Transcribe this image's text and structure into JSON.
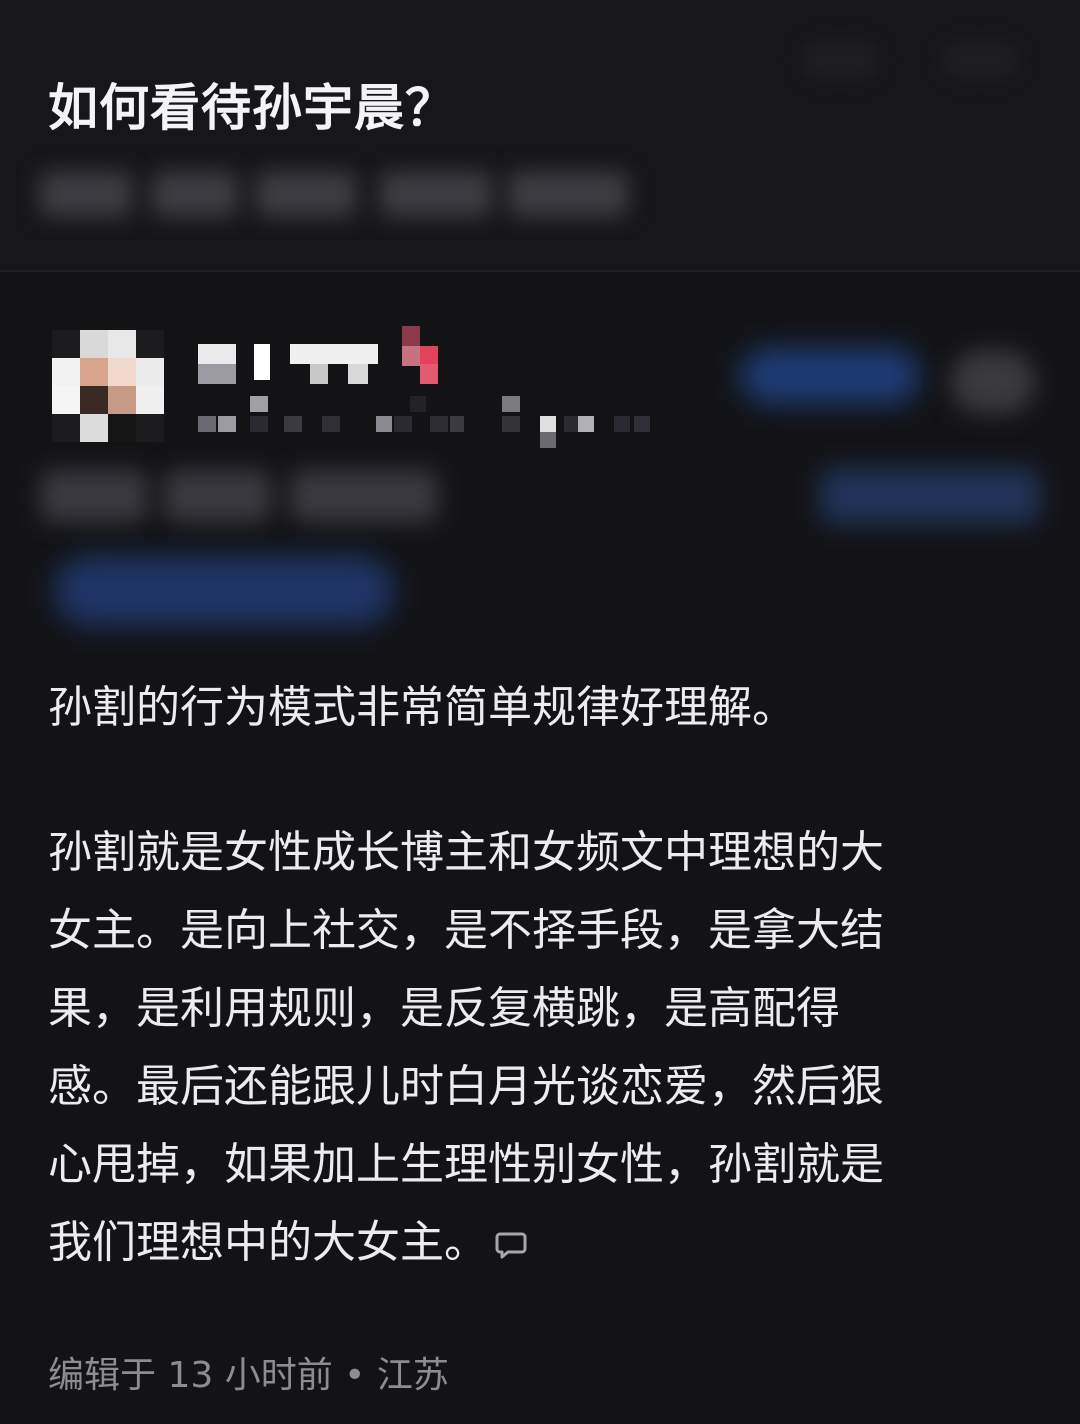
{
  "question": {
    "title": "如何看待孙宇晨？"
  },
  "answer": {
    "paragraphs": {
      "first": "孙割的行为模式非常简单规律好理解。",
      "second_lines": [
        "孙割就是女性成长博主和女频文中理想的大",
        "女主。是向上社交，是不择手段，是拿大结",
        "果，是利用规则，是反复横跳，是高配得",
        "感。最后还能跟儿时白月光谈恋爱，然后狠",
        "心甩掉，如果加上生理性别女性，孙割就是",
        "我们理想中的大女主。"
      ]
    },
    "footer": {
      "edited_label": "编辑于 13 小时前 • 江苏"
    },
    "icons": {
      "comment": "comment-bubble-icon"
    }
  },
  "colors": {
    "background": "#131316",
    "header_background": "#17171a",
    "text": "#ececee",
    "muted": "#8c8c92",
    "blurred_accent": "#1d3c74"
  }
}
